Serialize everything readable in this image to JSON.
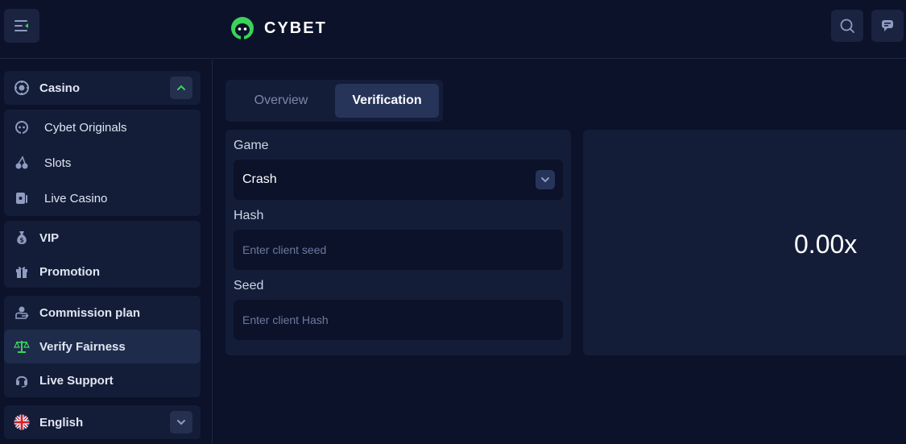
{
  "brand": {
    "name": "CYBET",
    "accent": "#3ad35a"
  },
  "header": {
    "icons": [
      "menu-icon",
      "search-icon",
      "chat-icon"
    ]
  },
  "sidebar": {
    "casino": {
      "label": "Casino",
      "icon": "casino-chip-icon",
      "expanded": true
    },
    "casino_items": [
      {
        "label": "Cybet Originals",
        "icon": "originals-icon"
      },
      {
        "label": "Slots",
        "icon": "cherries-icon"
      },
      {
        "label": "Live Casino",
        "icon": "cards-icon"
      }
    ],
    "group2": [
      {
        "label": "VIP",
        "icon": "money-bag-icon"
      },
      {
        "label": "Promotion",
        "icon": "gift-icon"
      }
    ],
    "group3": [
      {
        "label": "Commission plan",
        "icon": "hand-coin-icon"
      },
      {
        "label": "Verify Fairness",
        "icon": "scales-icon",
        "active": true
      },
      {
        "label": "Live Support",
        "icon": "headset-icon"
      }
    ],
    "language": {
      "label": "English",
      "icon": "uk-flag-icon"
    }
  },
  "tabs": [
    {
      "label": "Overview",
      "active": false
    },
    {
      "label": "Verification",
      "active": true
    }
  ],
  "form": {
    "game_label": "Game",
    "game_value": "Crash",
    "hash_label": "Hash",
    "hash_placeholder": "Enter client seed",
    "seed_label": "Seed",
    "seed_placeholder": "Enter client Hash"
  },
  "result": {
    "value": "0.00x"
  }
}
